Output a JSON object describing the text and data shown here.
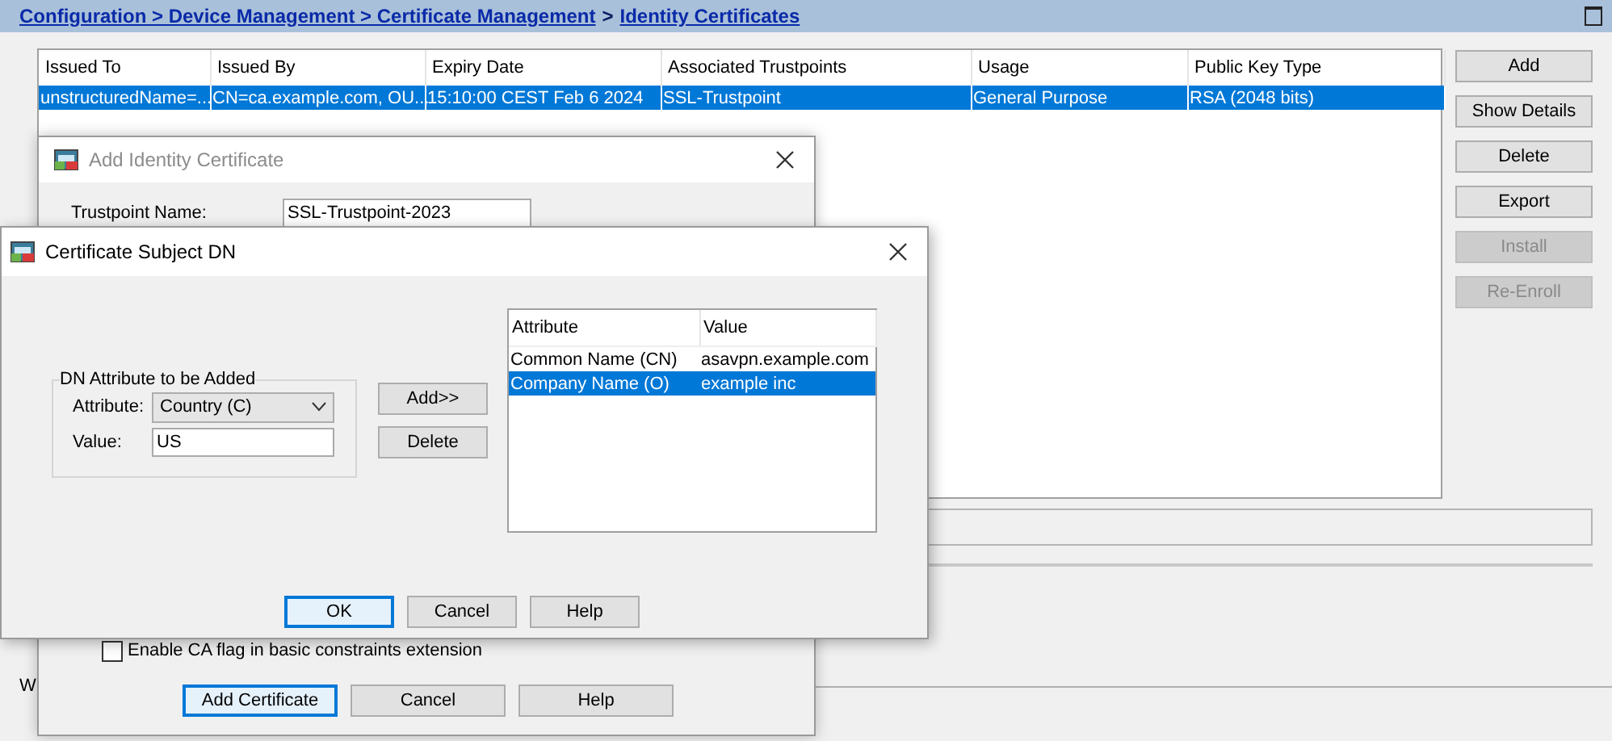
{
  "breadcrumb": {
    "path": "Configuration > Device Management > Certificate Management",
    "separator": ">",
    "current": "Identity Certificates"
  },
  "certificates_table": {
    "columns": [
      "Issued To",
      "Issued By",
      "Expiry Date",
      "Associated Trustpoints",
      "Usage",
      "Public Key Type"
    ],
    "rows": [
      {
        "cells": [
          "unstructuredName=...",
          "CN=ca.example.com, OU...",
          "15:10:00 CEST Feb 6 2024",
          "SSL-Trustpoint",
          "General Purpose",
          "RSA (2048 bits)"
        ],
        "selected": true
      }
    ]
  },
  "actions": [
    {
      "label": "Add",
      "disabled": false
    },
    {
      "label": "Show Details",
      "disabled": false
    },
    {
      "label": "Delete",
      "disabled": false
    },
    {
      "label": "Export",
      "disabled": false
    },
    {
      "label": "Install",
      "disabled": true
    },
    {
      "label": "Re-Enroll",
      "disabled": true
    }
  ],
  "footer_text": "W",
  "add_identity_dialog": {
    "title": "Add Identity Certificate",
    "active": false,
    "trustpoint_label": "Trustpoint Name:",
    "trustpoint_value": "SSL-Trustpoint-2023",
    "ca_flag": {
      "label": "Enable CA flag in basic constraints extension",
      "checked": false
    },
    "buttons": [
      {
        "label": "Add Certificate",
        "default": true
      },
      {
        "label": "Cancel",
        "default": false
      },
      {
        "label": "Help",
        "default": false
      }
    ]
  },
  "subject_dn_dialog": {
    "title": "Certificate Subject DN",
    "active": true,
    "group_title": "DN Attribute to be Added",
    "attribute_label": "Attribute:",
    "attribute_value": "Country (C)",
    "value_label": "Value:",
    "value": "US",
    "side_buttons": [
      "Add>>",
      "Delete"
    ],
    "table": {
      "columns": [
        "Attribute",
        "Value"
      ],
      "rows": [
        {
          "cells": [
            "Common Name (CN)",
            "asavpn.example.com"
          ],
          "selected": false
        },
        {
          "cells": [
            "Company Name (O)",
            "example inc"
          ],
          "selected": true
        }
      ]
    },
    "buttons": [
      {
        "label": "OK",
        "default": true
      },
      {
        "label": "Cancel",
        "default": false
      },
      {
        "label": "Help",
        "default": false
      }
    ]
  }
}
